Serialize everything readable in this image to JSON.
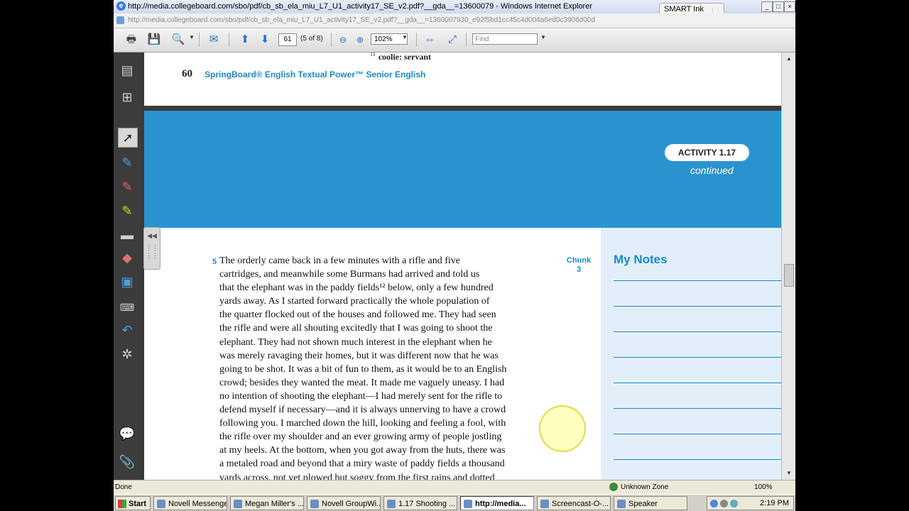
{
  "window": {
    "title": "http://media.collegeboard.com/sbo/pdf/cb_sb_ela_miu_L7_U1_activity17_SE_v2.pdf?__gda__=13600079 - Windows Internet Explorer",
    "smart_ink_label": "SMART Ink",
    "address": "http://media.collegeboard.com/sbo/pdf/cb_sb_ela_miu_L7_U1_activity17_SE_v2.pdf?__gda__=1360007930_e92f5bd1cc45c4d004a6ed0c3906d00d"
  },
  "toolbar": {
    "page_number": "61",
    "page_count": "(5 of 8)",
    "zoom": "102%",
    "find_placeholder": "Find"
  },
  "document": {
    "footnote_number": "11",
    "footnote_text": "coolie: servant",
    "page_number": "60",
    "running_head": "SpringBoard® English Textual Power™ Senior English",
    "activity_label": "ACTIVITY 1.17",
    "activity_sub": "continued",
    "paragraph_number": "5",
    "chunk_label": "Chunk",
    "chunk_number": "3",
    "notes_title": "My Notes",
    "body_lines": [
      "The orderly came back in a few minutes with a rifle and five",
      "cartridges, and meanwhile some Burmans had arrived and told us",
      "that the elephant was in the paddy fields¹² below, only a few hundred",
      "yards away. As I started forward practically the whole population of",
      "the quarter flocked out of the houses and followed me. They had seen",
      "the rifle and were all shouting excitedly that I was going to shoot the",
      "elephant. They had not shown much interest in the elephant when he",
      "was merely ravaging their homes, but it was different now that he was",
      "going to be shot. It was a bit of fun to them, as it would be to an English",
      "crowd; besides they wanted the meat. It made me vaguely uneasy. I had",
      "no intention of shooting the elephant—I had merely sent for the rifle to",
      "defend myself if necessary—and it is always unnerving to have a crowd",
      "following you. I marched down the hill, looking and feeling a fool, with",
      "the rifle over my shoulder and an ever growing army of people jostling",
      "at my heels. At the bottom, when you got away from the huts, there was",
      "a metaled road and beyond that a miry waste of paddy fields a thousand",
      "yards across, not yet plowed but soggy from the first rains and dotted"
    ]
  },
  "statusbar": {
    "left": "Done",
    "zone": "Unknown Zone",
    "zoom": "100%"
  },
  "taskbar": {
    "start": "Start",
    "tasks": [
      "Novell Messenger",
      "Megan Miller's ...",
      "Novell GroupWi...",
      "1.17 Shooting ...",
      "http://media...",
      "Screencast-O-...",
      "Speaker"
    ],
    "clock": "2:19 PM"
  },
  "icons": [
    "print-icon",
    "save-icon",
    "search-tool-icon",
    "email-icon",
    "page-up-icon",
    "page-down-icon",
    "zoom-out-icon",
    "zoom-in-icon",
    "fit-width-icon",
    "fit-page-icon",
    "pages-icon",
    "binoculars-icon",
    "select-arrow-icon",
    "pen-icon",
    "highlighter-icon",
    "eraser-icon",
    "undo-icon",
    "keyboard-icon",
    "comment-icon",
    "attachment-icon"
  ],
  "colors": {
    "brand_blue": "#1a8ac9",
    "banner": "#2a93cf",
    "notes_bg": "#e3eff8"
  }
}
